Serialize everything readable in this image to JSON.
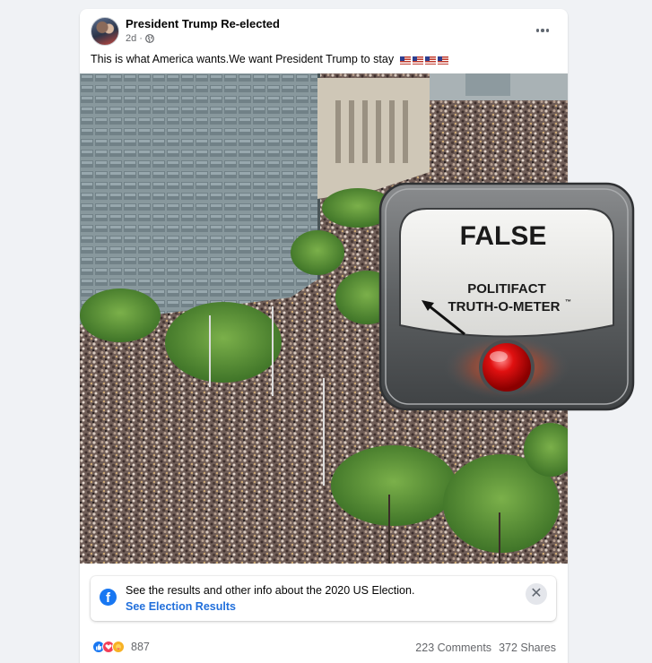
{
  "post": {
    "page_name": "President Trump Re-elected",
    "time": "2d",
    "separator": "·",
    "text": "This is what America wants.We want President Trump to stay",
    "flags_icon": "us-flag-emoji"
  },
  "election_banner": {
    "text": "See the results and other info about the 2020 US Election.",
    "link": "See Election Results",
    "close_symbol": "✕"
  },
  "engagement": {
    "reaction_count": "887",
    "comments": "223 Comments",
    "shares": "372 Shares"
  },
  "rating": {
    "verdict": "FALSE",
    "line1": "POLITIFACT",
    "line2": "TRUTH-O-METER",
    "trademark": "™"
  }
}
